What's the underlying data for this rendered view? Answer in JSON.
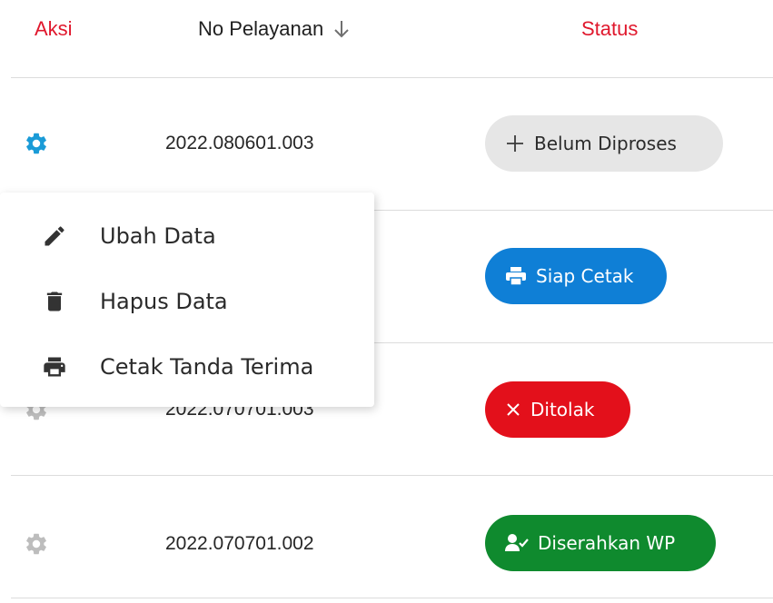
{
  "table": {
    "headers": {
      "aksi": "Aksi",
      "no_pelayanan": "No Pelayanan",
      "status": "Status"
    },
    "rows": [
      {
        "no_pelayanan": "2022.080601.003",
        "status": "Belum Diproses",
        "status_icon": "plus-icon",
        "status_color": "#e6e6e6"
      },
      {
        "no_pelayanan": "",
        "status": "Siap Cetak",
        "status_icon": "printer-icon",
        "status_color": "#0f7fd6"
      },
      {
        "no_pelayanan": "2022.070701.003",
        "status": "Ditolak",
        "status_icon": "close-icon",
        "status_color": "#e3101b"
      },
      {
        "no_pelayanan": "2022.070701.002",
        "status": "Diserahkan WP",
        "status_icon": "user-check-icon",
        "status_color": "#0f8a2e"
      }
    ]
  },
  "action_menu": {
    "items": [
      {
        "label": "Ubah Data",
        "icon": "pencil-icon"
      },
      {
        "label": "Hapus Data",
        "icon": "trash-icon"
      },
      {
        "label": "Cetak Tanda Terima",
        "icon": "printer-icon"
      }
    ]
  },
  "colors": {
    "header_accent": "#e0182d",
    "gear_active": "#1a9bd7",
    "gear_inactive": "#bdbdbd",
    "divider": "#dcdcdc"
  }
}
